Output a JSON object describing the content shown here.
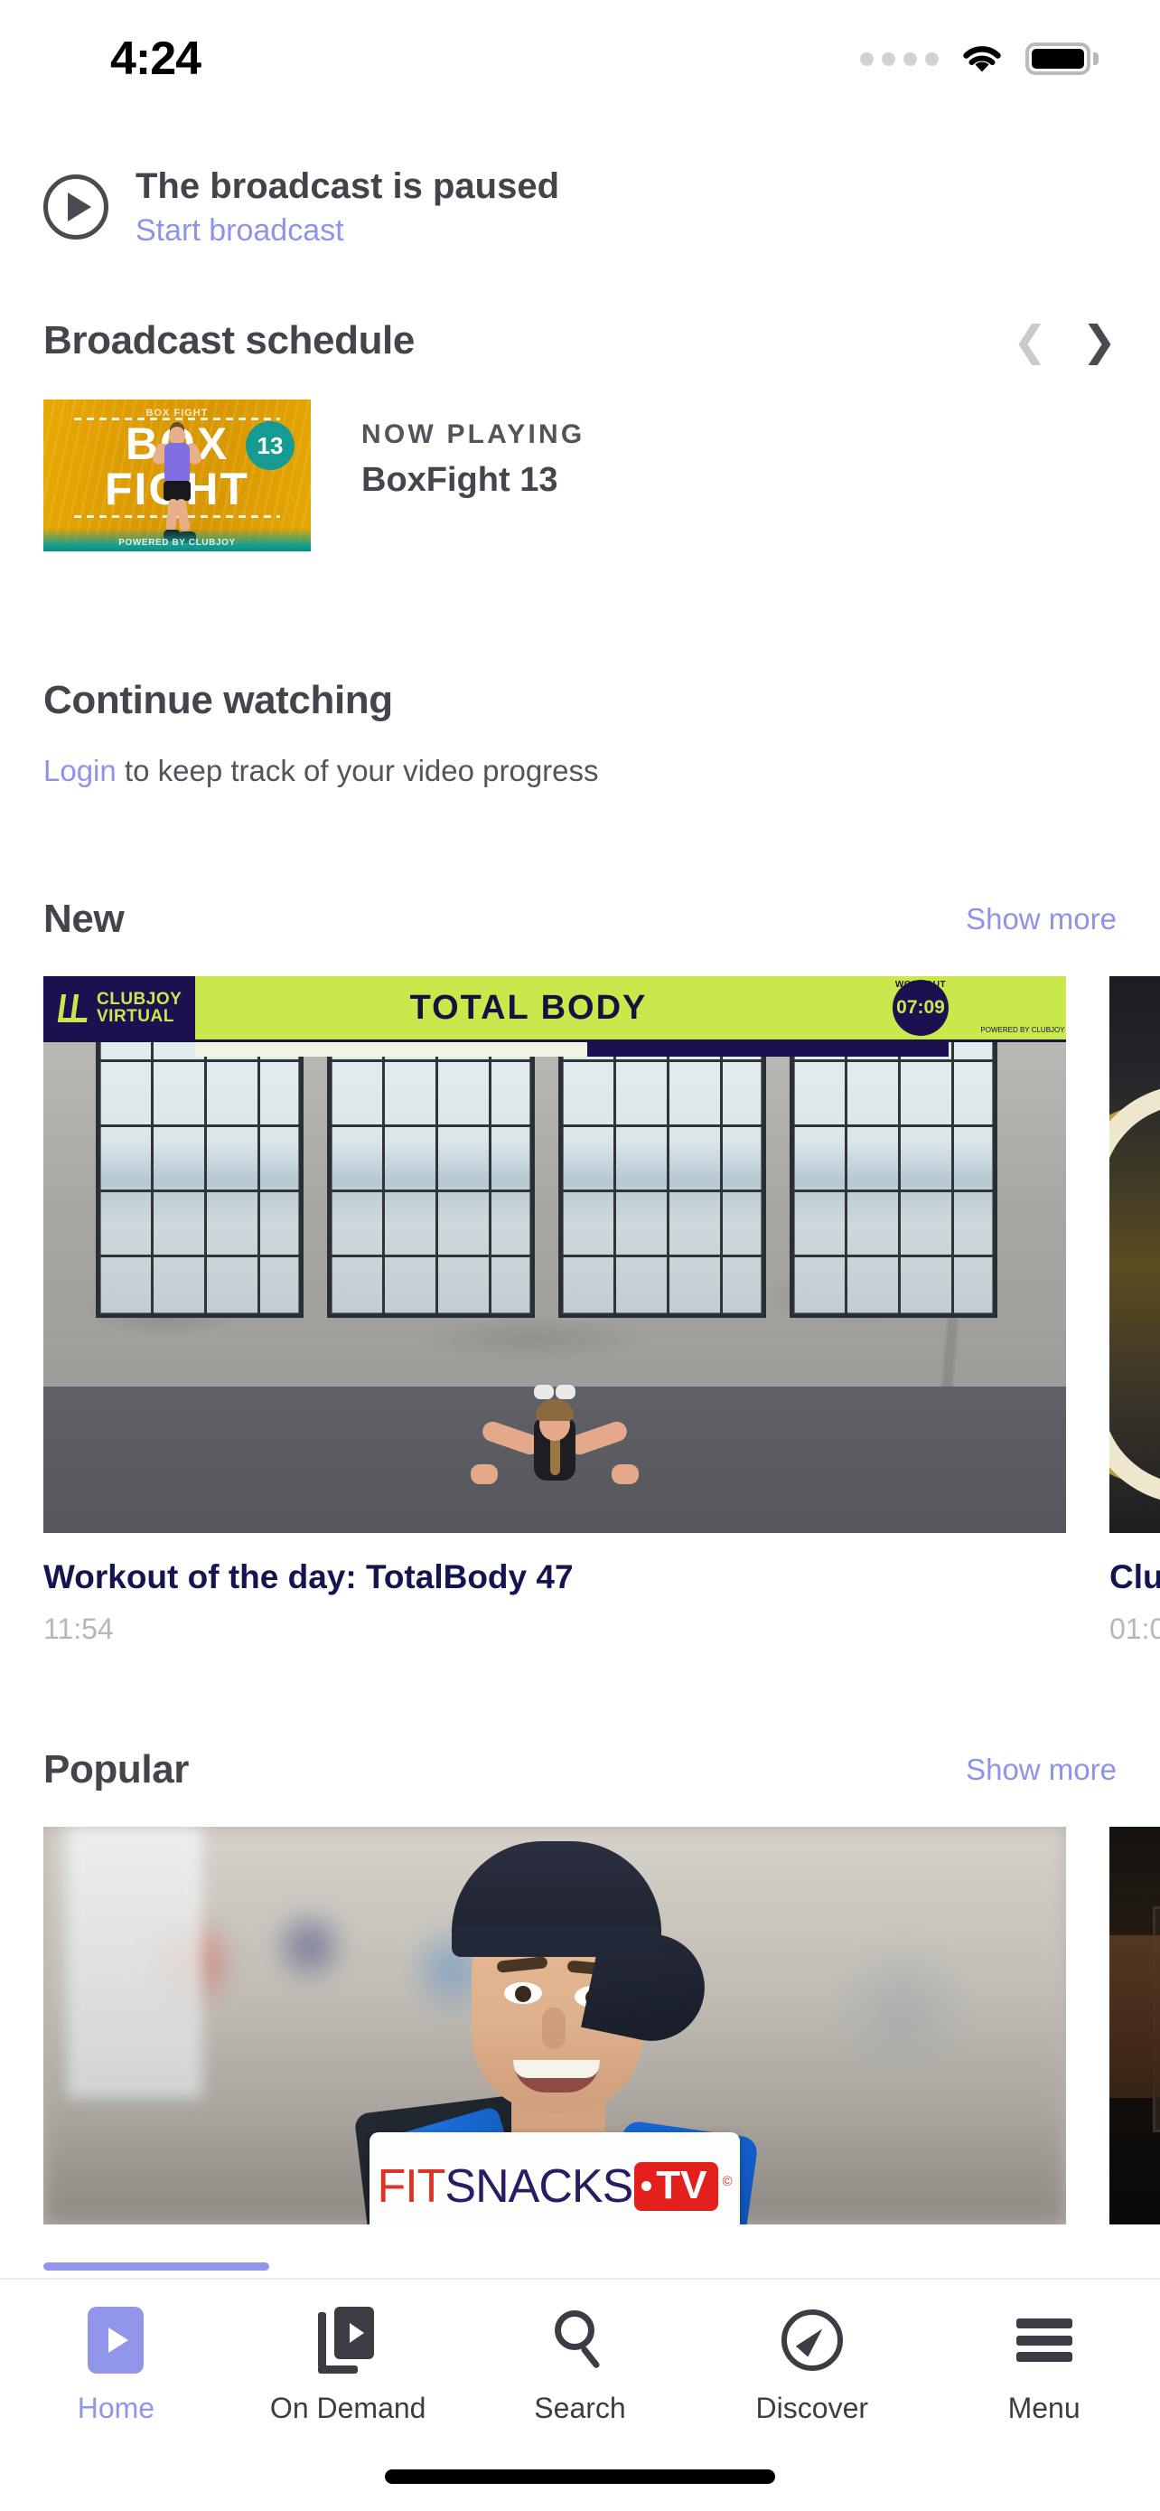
{
  "status_bar": {
    "time": "4:24",
    "signal_icon": "signal-dots-icon",
    "wifi_icon": "wifi-icon",
    "battery_icon": "battery-full-icon"
  },
  "broadcast": {
    "play_icon": "play-circle-icon",
    "title": "The broadcast is paused",
    "action_link": "Start broadcast"
  },
  "schedule": {
    "heading": "Broadcast schedule",
    "prev_icon": "chevron-left-icon",
    "next_icon": "chevron-right-icon",
    "thumbnail": {
      "top_label": "BOX FIGHT",
      "word_1": "BOX",
      "word_2": "FIGHT",
      "badge": "13",
      "powered_by": "POWERED BY CLUBJOY"
    },
    "now_playing_label": "NOW PLAYING",
    "now_playing_title": "BoxFight 13"
  },
  "continue_watching": {
    "heading": "Continue watching",
    "login_link": "Login",
    "login_rest": " to keep track of your video progress"
  },
  "new_section": {
    "heading": "New",
    "show_more": "Show more",
    "items": [
      {
        "title": "Workout of the day: TotalBody 47",
        "duration": "11:54",
        "overlay": {
          "brand_line_1": "CLUBJOY",
          "brand_line_2": "VIRTUAL",
          "banner_title": "TOTAL BODY",
          "timer_label": "WORKOUT",
          "timer_value": "07:09",
          "powered_by": "POWERED BY CLUBJOY"
        }
      },
      {
        "title": "Clu",
        "duration": "01:0"
      }
    ]
  },
  "popular_section": {
    "heading": "Popular",
    "show_more": "Show more",
    "items": [
      {
        "logo_fit": "FIT",
        "logo_snacks": "SNACKS",
        "logo_tv": "TV",
        "logo_copyright": "©"
      }
    ]
  },
  "tabbar": {
    "items": [
      {
        "label": "Home",
        "icon": "home-play-icon",
        "active": true
      },
      {
        "label": "On Demand",
        "icon": "on-demand-library-icon",
        "active": false
      },
      {
        "label": "Search",
        "icon": "search-icon",
        "active": false
      },
      {
        "label": "Discover",
        "icon": "compass-icon",
        "active": false
      },
      {
        "label": "Menu",
        "icon": "hamburger-menu-icon",
        "active": false
      }
    ]
  },
  "colors": {
    "accent": "#9296ea",
    "link": "#8f93e8",
    "heading": "#44444c",
    "title_navy": "#141450",
    "muted": "#b6b6bb",
    "badge_teal": "#169b93",
    "banner_lime": "#c8e84b"
  }
}
